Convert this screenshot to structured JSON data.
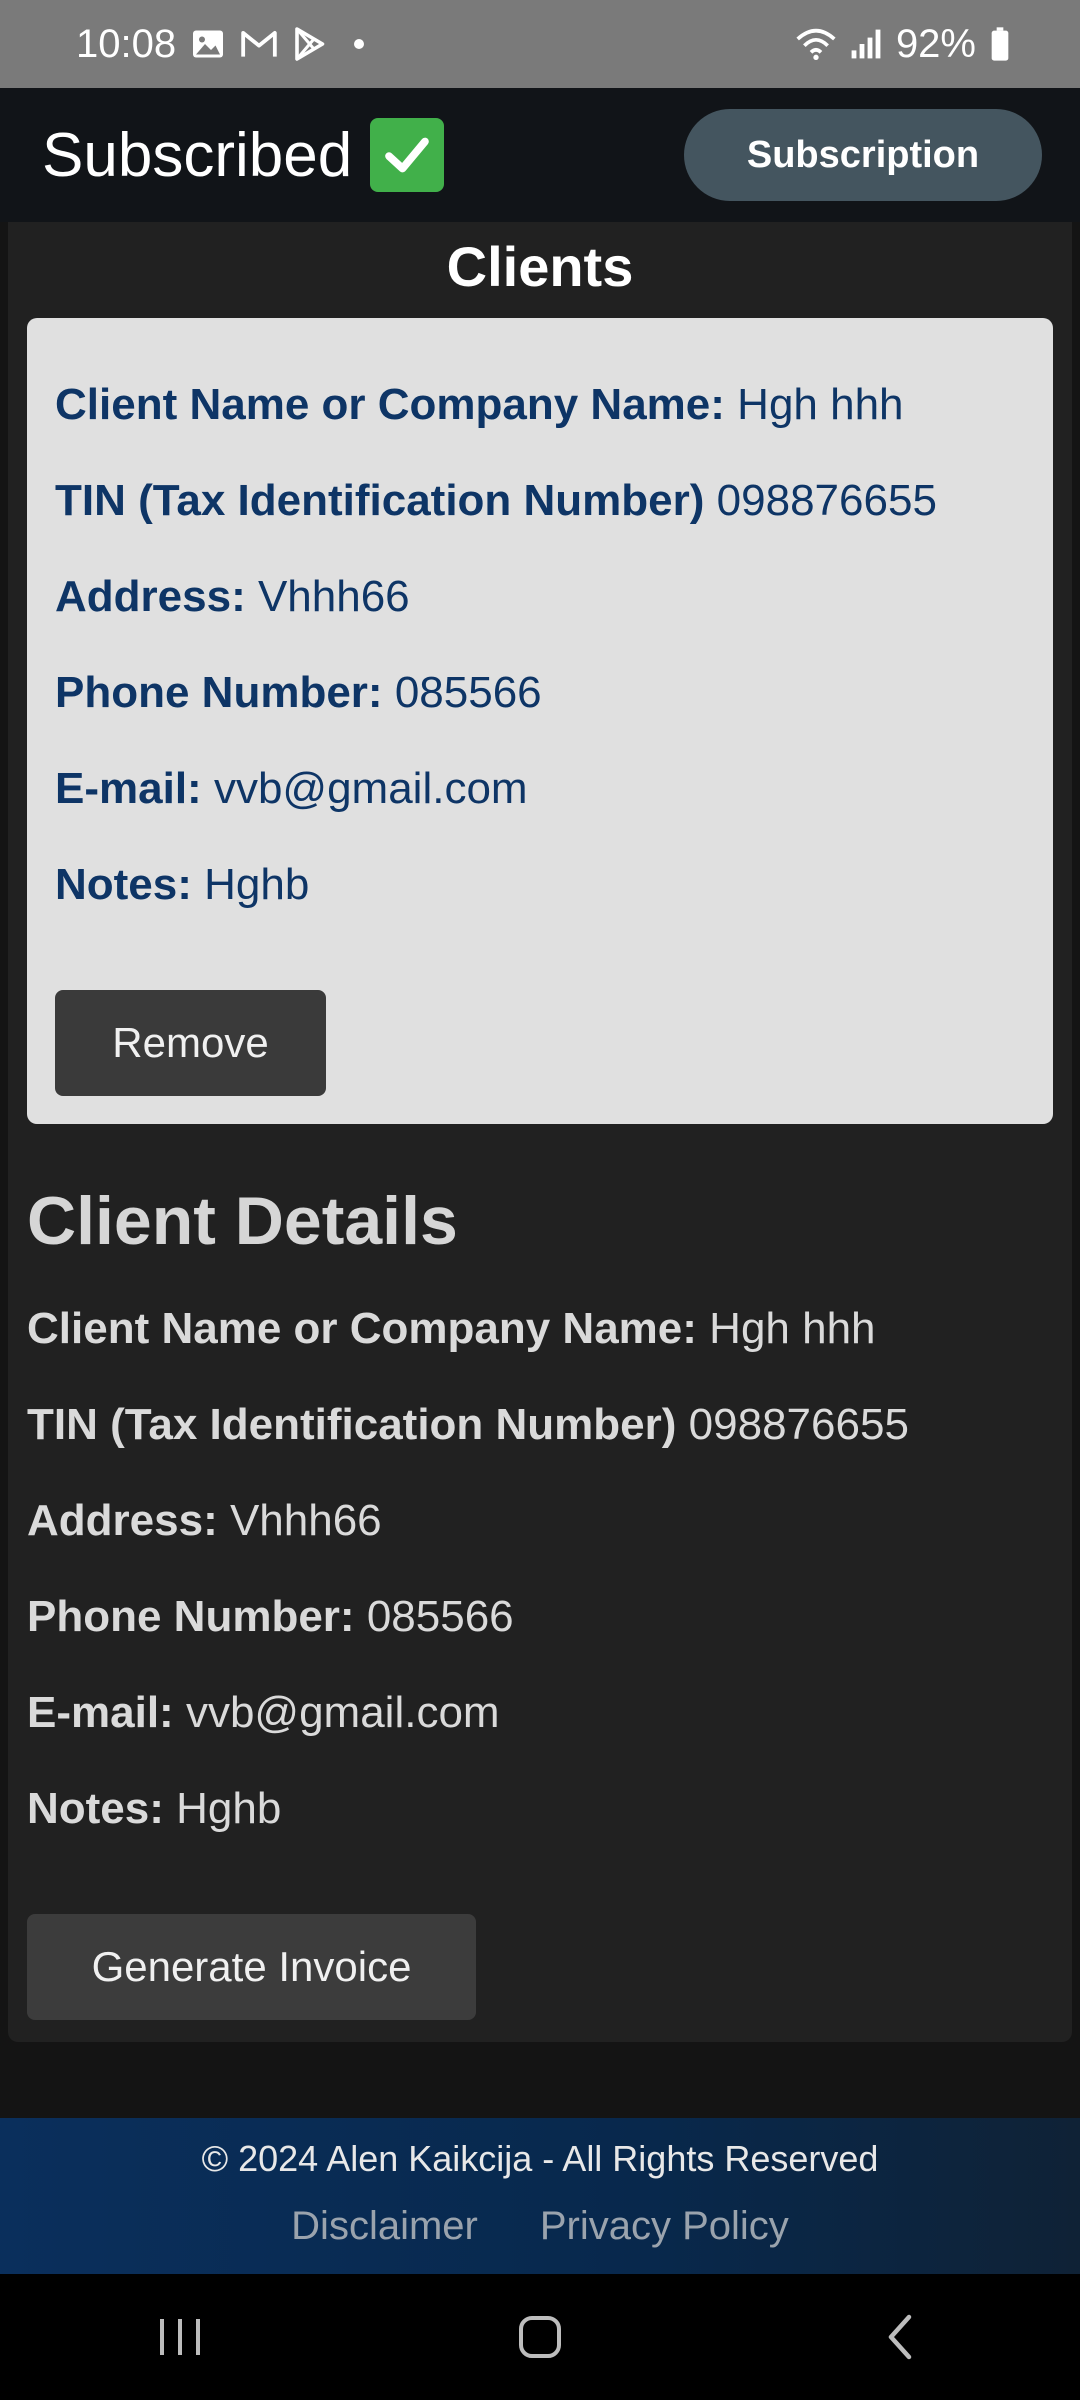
{
  "status_bar": {
    "time": "10:08",
    "battery": "92%",
    "icons": [
      "image-icon",
      "gmail-icon",
      "play-store-icon",
      "wifi-icon",
      "signal-icon",
      "battery-icon"
    ]
  },
  "header": {
    "title": "Subscribed",
    "status_icon": "check-mark-icon",
    "subscription_label": "Subscription"
  },
  "clients": {
    "heading": "Clients",
    "card": {
      "rows": [
        {
          "label": "Client Name or Company Name:",
          "value": "Hgh hhh"
        },
        {
          "label": "TIN (Tax Identification Number)",
          "value": "098876655"
        },
        {
          "label": "Address:",
          "value": "Vhhh66"
        },
        {
          "label": "Phone Number:",
          "value": "085566"
        },
        {
          "label": "E-mail:",
          "value": "vvb@gmail.com"
        },
        {
          "label": "Notes:",
          "value": "Hghb"
        }
      ],
      "remove_label": "Remove"
    }
  },
  "client_details": {
    "heading": "Client Details",
    "rows": [
      {
        "label": "Client Name or Company Name:",
        "value": "Hgh hhh"
      },
      {
        "label": "TIN (Tax Identification Number)",
        "value": "098876655"
      },
      {
        "label": "Address:",
        "value": "Vhhh66"
      },
      {
        "label": "Phone Number:",
        "value": "085566"
      },
      {
        "label": "E-mail:",
        "value": "vvb@gmail.com"
      },
      {
        "label": "Notes:",
        "value": "Hghb"
      }
    ],
    "generate_label": "Generate Invoice"
  },
  "footer": {
    "copyright": "© 2024 Alen Kaikcija - All Rights Reserved",
    "links": [
      "Disclaimer",
      "Privacy Policy"
    ]
  },
  "colors": {
    "header_bg": "#111418",
    "panel_bg": "#212121",
    "card_bg": "#e0e0e0",
    "card_text": "#0e3566",
    "accent_button": "#44555f",
    "footer_bg": "#0a2f5c"
  }
}
